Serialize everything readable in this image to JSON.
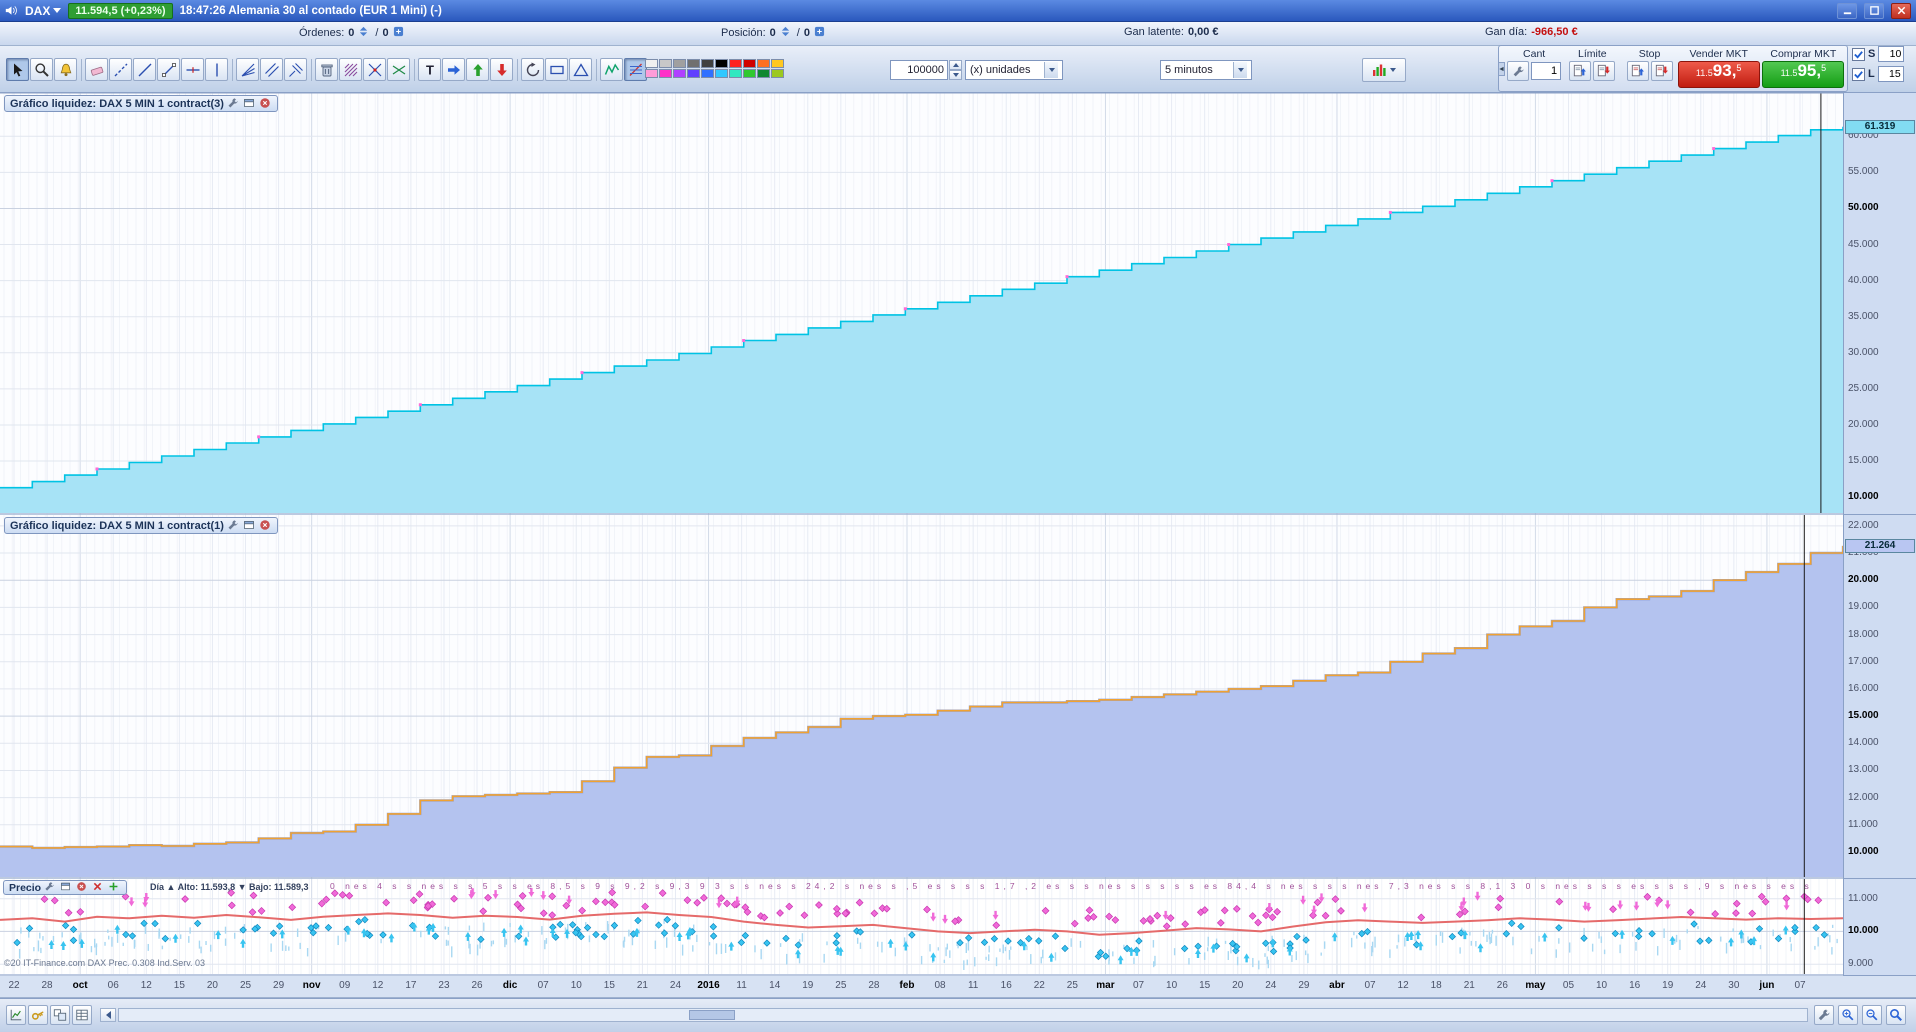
{
  "titlebar": {
    "symbol": "DAX",
    "price_badge": "11.594,5 (+0,23%)",
    "session_info": "18:47:26 Alemania 30 al contado (EUR 1 Mini) (-)"
  },
  "infobar": {
    "ordenes_label": "Órdenes:",
    "ordenes_open": "0",
    "ordenes_sep": "/",
    "ordenes_pending": "0",
    "posicion_label": "Posición:",
    "posicion_qty": "0",
    "posicion_sep": "/",
    "posicion_qty2": "0",
    "gan_latente_label": "Gan latente:",
    "gan_latente_value": "0,00 €",
    "gan_dia_label": "Gan día:",
    "gan_dia_value": "-966,50 €"
  },
  "toolbar": {
    "qty_value": "100000",
    "units_value": "(x) unidades",
    "timeframe_value": "5 minutos",
    "tools": [
      {
        "name": "pointer-tool",
        "icon": "pointer",
        "pressed": true
      },
      {
        "name": "zoom-tool",
        "icon": "zoom"
      },
      {
        "name": "alarm-tool",
        "icon": "alarm"
      },
      {
        "sep": true
      },
      {
        "name": "eraser-tool",
        "icon": "eraser"
      },
      {
        "name": "trendline-dashed-tool",
        "icon": "dashline"
      },
      {
        "name": "trendline-tool",
        "icon": "line"
      },
      {
        "name": "segment-tool",
        "icon": "segment"
      },
      {
        "name": "horizontal-line-tool",
        "icon": "hline"
      },
      {
        "name": "vertical-line-tool",
        "icon": "vline"
      },
      {
        "sep": true
      },
      {
        "name": "fan-lines-tool",
        "icon": "fan"
      },
      {
        "name": "parallel-lines-tool",
        "icon": "parallel"
      },
      {
        "name": "pitchfork-tool",
        "icon": "pitchfork"
      },
      {
        "sep": true
      },
      {
        "name": "delete-drawings-tool",
        "icon": "trash"
      },
      {
        "name": "hatch-tool",
        "icon": "hatch"
      },
      {
        "name": "cross-tool",
        "icon": "crossblue"
      },
      {
        "name": "cross-alt-tool",
        "icon": "crossgreen"
      },
      {
        "sep": true
      },
      {
        "name": "text-tool",
        "icon": "text"
      },
      {
        "name": "arrow-right-tool",
        "icon": "arrowright"
      },
      {
        "name": "arrow-up-tool",
        "icon": "arrowup"
      },
      {
        "name": "arrow-down-tool",
        "icon": "arrowdown"
      },
      {
        "sep": true
      },
      {
        "name": "rotate-tool",
        "icon": "lasso"
      },
      {
        "name": "rectangle-tool",
        "icon": "rect"
      },
      {
        "name": "triangle-tool",
        "icon": "triangle"
      },
      {
        "sep": true
      },
      {
        "name": "zigzag-tool",
        "icon": "zigzag"
      },
      {
        "name": "retracement-tool",
        "icon": "retracement",
        "pressed": true
      }
    ],
    "palette": [
      [
        "#f0f0f0",
        "#c8c8c8",
        "#a0a0a0",
        "#707070",
        "#404040",
        "#000000",
        "#ff2020",
        "#d00000",
        "#ff7020",
        "#ffc820"
      ],
      [
        "#ff9cd8",
        "#ff30c8",
        "#b040ff",
        "#6040ff",
        "#3070ff",
        "#30c8ff",
        "#30e8c0",
        "#30c830",
        "#108830",
        "#9cc820"
      ]
    ]
  },
  "trade_panel": {
    "cant_label": "Cant",
    "cant_value": "1",
    "limite_label": "Límite",
    "stop_label": "Stop",
    "sell_label": "Vender MKT",
    "buy_label": "Comprar MKT",
    "sell_price": {
      "prefix": "11.5",
      "main": "93,",
      "sup": "5"
    },
    "buy_price": {
      "prefix": "11.5",
      "main": "95,",
      "sup": "5"
    },
    "s_label": "S",
    "s_value": "10",
    "l_label": "L",
    "l_value": "15"
  },
  "price_panel": {
    "day_info": "Día ▲ Alto: 11.593,8 ▼ Bajo: 11.589,3",
    "noise_row": "0 nes 4 s s nes s s 5 s s es 8,5 s 9 s 9,2 s 9,3 9 3 s s nes s 24,2 s nes s ,5 es s s s 1,7 ,2 es s s nes s s s s s es 84,4 s nes s s s nes 7,3 nes s s 8,1 3 0 s nes s s s es s s s ,9 s nes s es s s ,0 s nes s s 0,3 nes s es s s s s s",
    "copyright": "©20 IT-Finance.com DAX Prec. 0.308 Ind.Serv. 03"
  },
  "dates": {
    "labels": [
      "22",
      "28",
      "oct",
      "06",
      "12",
      "15",
      "20",
      "25",
      "29",
      "nov",
      "09",
      "12",
      "17",
      "23",
      "26",
      "dic",
      "07",
      "10",
      "15",
      "21",
      "24",
      "2016",
      "11",
      "14",
      "19",
      "25",
      "28",
      "feb",
      "08",
      "11",
      "16",
      "22",
      "25",
      "mar",
      "07",
      "10",
      "15",
      "20",
      "24",
      "29",
      "abr",
      "07",
      "12",
      "18",
      "21",
      "26",
      "may",
      "05",
      "10",
      "16",
      "19",
      "24",
      "30",
      "jun",
      "07"
    ],
    "bold": [
      "oct",
      "nov",
      "dic",
      "2016",
      "feb",
      "mar",
      "abr",
      "may",
      "jun"
    ]
  },
  "chart_data": [
    {
      "type": "area",
      "title": "Gráfico liquidez: DAX 5 MIN 1 contract(3)",
      "xlabel": "",
      "ylabel": "",
      "ylim": [
        7800,
        66000
      ],
      "grid": true,
      "line_color": "#00c3e4",
      "fill_color": "#a7e3f6",
      "badge_color": "#82dcf2",
      "cursor_frac": 0.988,
      "yticks": [
        {
          "label": "60.000",
          "v": 60000
        },
        {
          "label": "55.000",
          "v": 55000
        },
        {
          "label": "50.000",
          "v": 50000,
          "bold": true
        },
        {
          "label": "45.000",
          "v": 45000
        },
        {
          "label": "40.000",
          "v": 40000
        },
        {
          "label": "35.000",
          "v": 35000
        },
        {
          "label": "30.000",
          "v": 30000
        },
        {
          "label": "25.000",
          "v": 25000
        },
        {
          "label": "20.000",
          "v": 20000
        },
        {
          "label": "15.000",
          "v": 15000
        },
        {
          "label": "10.000",
          "v": 10000,
          "bold": true
        }
      ],
      "last": {
        "label": "61.319",
        "v": 61319
      },
      "values": [
        11300,
        12150,
        13050,
        13900,
        14800,
        15700,
        16600,
        17500,
        18350,
        19250,
        20150,
        21050,
        21900,
        22800,
        23700,
        24600,
        25450,
        26350,
        27250,
        28150,
        29000,
        29900,
        30800,
        31700,
        32550,
        33450,
        34350,
        35250,
        36100,
        37000,
        37900,
        38800,
        39650,
        40550,
        41450,
        42350,
        43200,
        44100,
        45000,
        45900,
        46750,
        47650,
        48550,
        49450,
        50300,
        51200,
        52100,
        53000,
        53850,
        54750,
        55650,
        56550,
        57400,
        58300,
        59200,
        60100,
        60900,
        61319
      ]
    },
    {
      "type": "area",
      "title": "Gráfico liquidez: DAX 5 MIN 1 contract(1)",
      "xlabel": "",
      "ylabel": "",
      "ylim": [
        9080,
        22400
      ],
      "grid": true,
      "line_color": "#f0a232",
      "fill_color": "#b4c3ef",
      "under_color": "#8fa3dd",
      "badge_color": "#b9c6f2",
      "cursor_frac": 0.979,
      "yticks": [
        {
          "label": "22.000",
          "v": 22000
        },
        {
          "label": "21.000",
          "v": 21000
        },
        {
          "label": "20.000",
          "v": 20000,
          "bold": true
        },
        {
          "label": "19.000",
          "v": 19000
        },
        {
          "label": "18.000",
          "v": 18000
        },
        {
          "label": "17.000",
          "v": 17000
        },
        {
          "label": "16.000",
          "v": 16000
        },
        {
          "label": "15.000",
          "v": 15000,
          "bold": true
        },
        {
          "label": "14.000",
          "v": 14000
        },
        {
          "label": "13.000",
          "v": 13000
        },
        {
          "label": "12.000",
          "v": 12000
        },
        {
          "label": "11.000",
          "v": 11000
        },
        {
          "label": "10.000",
          "v": 10000,
          "bold": true
        }
      ],
      "last": {
        "label": "21.264",
        "v": 21264
      },
      "values": [
        10200,
        10150,
        10180,
        10200,
        10250,
        10220,
        10300,
        10350,
        10500,
        10700,
        10750,
        11000,
        11400,
        11900,
        12050,
        12100,
        12150,
        12200,
        12600,
        13100,
        13500,
        13550,
        13900,
        14200,
        14400,
        14600,
        14900,
        15000,
        15050,
        15200,
        15350,
        15500,
        15500,
        15550,
        15600,
        15700,
        15800,
        15900,
        16000,
        16100,
        16300,
        16500,
        16600,
        17000,
        17300,
        17500,
        18000,
        18300,
        18500,
        19000,
        19300,
        19400,
        19600,
        20000,
        20300,
        20600,
        21000,
        21264
      ]
    },
    {
      "type": "scatter",
      "title": "Precio",
      "xlabel": "",
      "ylabel": "",
      "ylim": [
        8700,
        11600
      ],
      "grid": true,
      "line_color": "#e56a6a",
      "cursor_frac": 0.979,
      "yticks": [
        {
          "label": "11.000",
          "v": 11000
        },
        {
          "label": "10.000",
          "v": 10000,
          "bold": true
        },
        {
          "label": "9.000",
          "v": 9000
        }
      ],
      "line_values": [
        10350,
        10400,
        10300,
        10450,
        10400,
        10480,
        10420,
        10500,
        10430,
        10350,
        10450,
        10500,
        10550,
        10500,
        10420,
        10480,
        10440,
        10360,
        10480,
        10540,
        10580,
        10500,
        10440,
        10300,
        10200,
        10120,
        10160,
        10200,
        10100,
        10000,
        9950,
        10000,
        10050,
        10000,
        9900,
        9950,
        10020,
        10100,
        10060,
        10000,
        10150,
        10280,
        10340,
        10300,
        10260,
        10300,
        10340,
        10400,
        10360,
        10300,
        10340,
        10390,
        10440,
        10400,
        10360,
        10400,
        10380,
        10400
      ],
      "markers": {
        "pink_color": "#f06ad8",
        "cyan_color": "#38c4f0",
        "tick_color": "#a9d8f2",
        "pink_count": 120,
        "cyan_count": 115,
        "arrow_up_count": 55,
        "arrow_down_count": 30,
        "tick_count": 260,
        "seed": 99
      }
    }
  ]
}
